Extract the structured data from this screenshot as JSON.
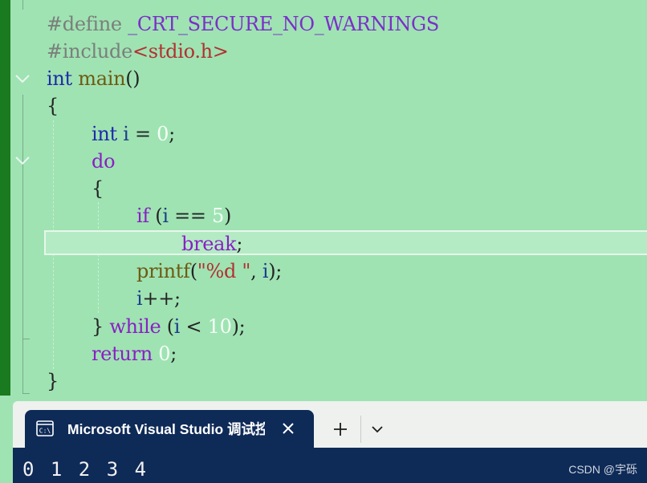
{
  "editor": {
    "lines": [
      {
        "tokens": [
          {
            "t": "#define ",
            "c": "pp"
          },
          {
            "t": "_CRT_SECURE_NO_WARNINGS",
            "c": "macro"
          }
        ]
      },
      {
        "tokens": [
          {
            "t": "#include",
            "c": "pp"
          },
          {
            "t": "<stdio.h>",
            "c": "str"
          }
        ]
      },
      {
        "tokens": [
          {
            "t": "int",
            "c": "kw"
          },
          {
            "t": " ",
            "c": "plain"
          },
          {
            "t": "main",
            "c": "fn"
          },
          {
            "t": "()",
            "c": "plain"
          }
        ]
      },
      {
        "tokens": [
          {
            "t": "{",
            "c": "plain"
          }
        ]
      },
      {
        "tokens": [
          {
            "t": "int",
            "c": "kw"
          },
          {
            "t": " ",
            "c": "plain"
          },
          {
            "t": "i",
            "c": "var"
          },
          {
            "t": " = ",
            "c": "plain"
          },
          {
            "t": "0",
            "c": "num"
          },
          {
            "t": ";",
            "c": "plain"
          }
        ]
      },
      {
        "tokens": [
          {
            "t": "do",
            "c": "kw2"
          }
        ]
      },
      {
        "tokens": [
          {
            "t": "{",
            "c": "plain"
          }
        ]
      },
      {
        "tokens": [
          {
            "t": "if",
            "c": "kw2"
          },
          {
            "t": " (",
            "c": "plain"
          },
          {
            "t": "i",
            "c": "var"
          },
          {
            "t": " == ",
            "c": "plain"
          },
          {
            "t": "5",
            "c": "num"
          },
          {
            "t": ")",
            "c": "plain"
          }
        ]
      },
      {
        "tokens": [
          {
            "t": "break",
            "c": "kw2"
          },
          {
            "t": ";",
            "c": "plain"
          }
        ]
      },
      {
        "tokens": [
          {
            "t": "printf",
            "c": "fn"
          },
          {
            "t": "(",
            "c": "plain"
          },
          {
            "t": "\"%d \"",
            "c": "str"
          },
          {
            "t": ", ",
            "c": "plain"
          },
          {
            "t": "i",
            "c": "var"
          },
          {
            "t": ");",
            "c": "plain"
          }
        ]
      },
      {
        "tokens": [
          {
            "t": "i",
            "c": "var"
          },
          {
            "t": "++;",
            "c": "plain"
          }
        ]
      },
      {
        "tokens": [
          {
            "t": "} ",
            "c": "plain"
          },
          {
            "t": "while",
            "c": "kw2"
          },
          {
            "t": " (",
            "c": "plain"
          },
          {
            "t": "i",
            "c": "var"
          },
          {
            "t": " < ",
            "c": "plain"
          },
          {
            "t": "10",
            "c": "num"
          },
          {
            "t": ");",
            "c": "plain"
          }
        ]
      },
      {
        "tokens": [
          {
            "t": "return",
            "c": "kw2"
          },
          {
            "t": " ",
            "c": "plain"
          },
          {
            "t": "0",
            "c": "num"
          },
          {
            "t": ";",
            "c": "plain"
          }
        ]
      },
      {
        "tokens": [
          {
            "t": "}",
            "c": "plain"
          }
        ]
      }
    ]
  },
  "terminal": {
    "tab_title": "Microsoft Visual Studio 调试控制台",
    "icons": {
      "tab": "console-icon",
      "close": "close-icon",
      "new_tab": "plus-icon",
      "dropdown": "chevron-down-icon"
    },
    "output": "0 1 2 3 4",
    "watermark": "CSDN @宇砾"
  },
  "colors": {
    "editor_bg": "#9fe3b3",
    "gutter_bar": "#1a7a1f",
    "terminal_bg": "#0e2a57",
    "keyword_blue": "#1f2ba8",
    "keyword_purple": "#8a1fc4",
    "string_red": "#b23131"
  }
}
